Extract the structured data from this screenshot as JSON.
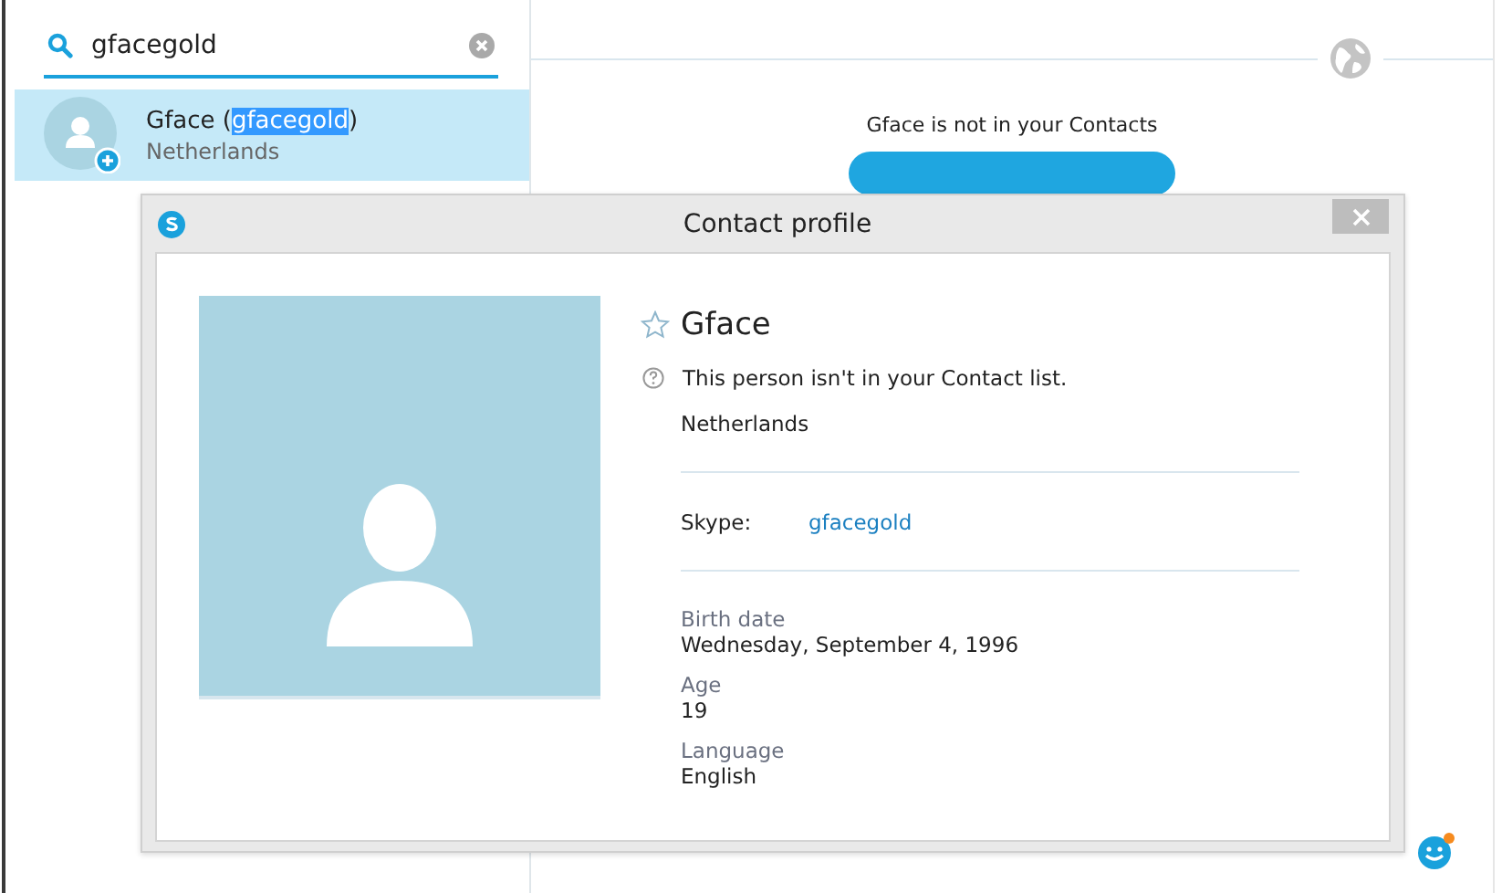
{
  "search": {
    "value": "gfacegold"
  },
  "results": [
    {
      "name": "Gface",
      "open_paren": "(",
      "username": "gfacegold",
      "close_paren": ")",
      "username_highlighted": true,
      "location": "Netherlands",
      "selected": true
    }
  ],
  "conversation": {
    "notice": "Gface is not in your Contacts"
  },
  "dialog": {
    "title": "Contact profile",
    "name": "Gface",
    "favorite": false,
    "status_note": "This person isn't in your Contact list.",
    "location": "Netherlands",
    "skype_label": "Skype:",
    "skype_id": "gfacegold",
    "details": [
      {
        "label": "Birth date",
        "value": "Wednesday, September 4, 1996"
      },
      {
        "label": "Age",
        "value": "19"
      },
      {
        "label": "Language",
        "value": "English"
      }
    ]
  }
}
